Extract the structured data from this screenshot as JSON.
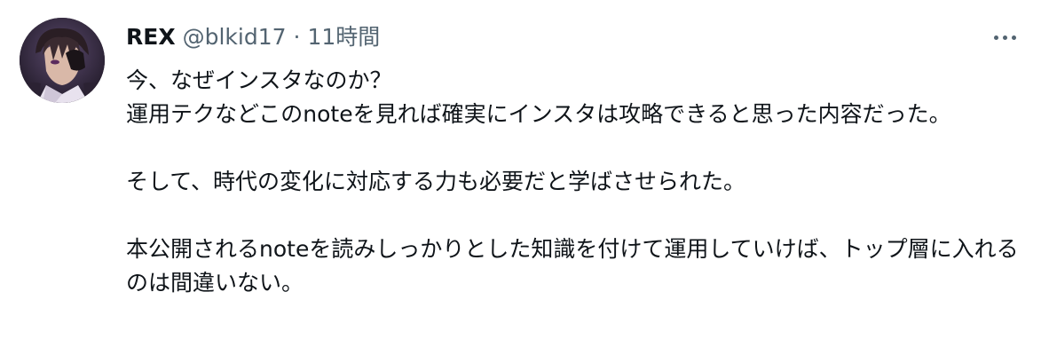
{
  "tweet": {
    "display_name": "REX",
    "handle": "@blkid17",
    "separator": "·",
    "time": "11時間",
    "more_icon": "ellipsis-icon",
    "avatar_icon": "user-avatar",
    "paragraphs": [
      "今、なぜインスタなのか？",
      "運用テクなどこのnoteを見れば確実にインスタは攻略できると思った内容だった。",
      "そして、時代の変化に対応する力も必要だと学ばさせられた。",
      "本公開されるnoteを読みしっかりとした知識を付けて運用していけば、トップ層に入れるのは間違いない。"
    ],
    "colors": {
      "text": "#0f1419",
      "secondary": "#536471",
      "background": "#ffffff"
    }
  }
}
